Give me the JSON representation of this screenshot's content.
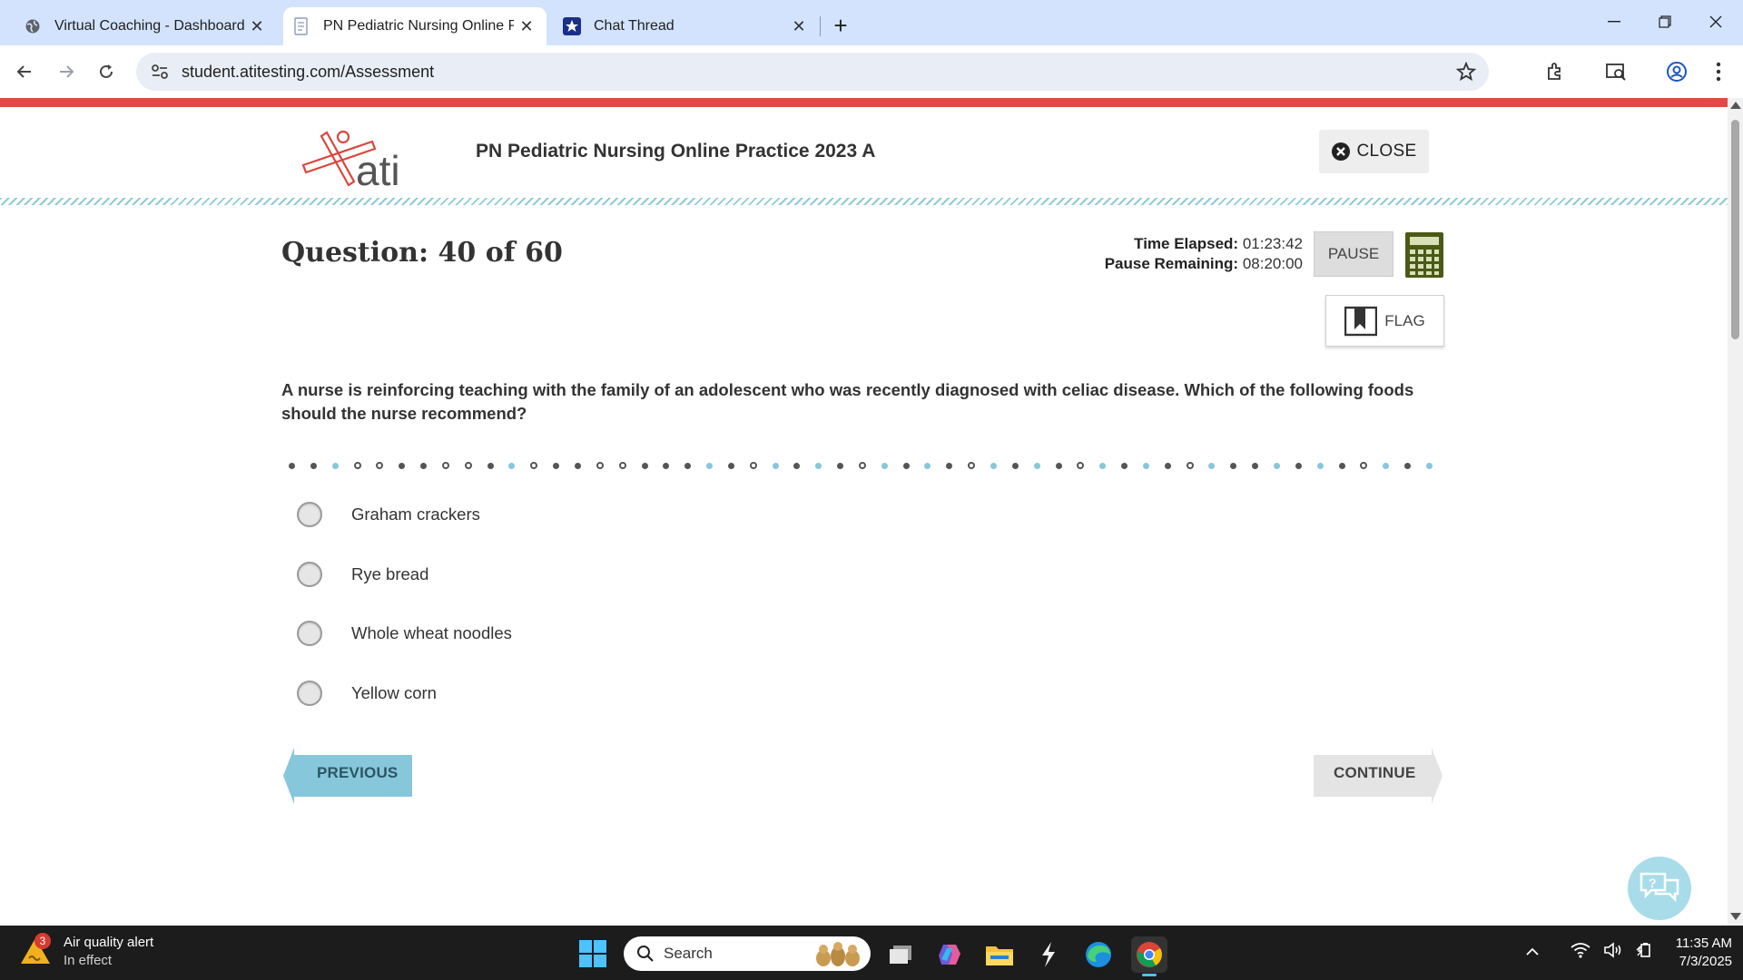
{
  "browser": {
    "tabs": [
      {
        "title": "Virtual Coaching - Dashboard",
        "icon": "globe-icon",
        "active": false
      },
      {
        "title": "PN Pediatric Nursing Online Pra",
        "icon": "document-icon",
        "active": true
      },
      {
        "title": "Chat Thread",
        "icon": "star-badge-icon",
        "active": false
      }
    ],
    "url": "student.atitesting.com/Assessment"
  },
  "header": {
    "logo_text": "ati",
    "exam_title": "PN Pediatric Nursing Online Practice 2023 A",
    "close_label": "CLOSE"
  },
  "status": {
    "question_label": "Question: 40 of 60",
    "time_elapsed_label": "Time Elapsed:",
    "time_elapsed_value": "01:23:42",
    "pause_remaining_label": "Pause Remaining:",
    "pause_remaining_value": "08:20:00",
    "pause_label": "PAUSE",
    "flag_label": "FLAG"
  },
  "question": {
    "text": "A nurse is reinforcing teaching with the family of an adolescent who was recently diagnosed with celiac disease. Which of the following foods should the nurse recommend?",
    "options": [
      "Graham crackers",
      "Rye bread",
      "Whole wheat noodles",
      "Yellow corn"
    ]
  },
  "progress_dots": [
    "d",
    "d",
    "b",
    "r",
    "r",
    "d",
    "d",
    "r",
    "r",
    "d",
    "b",
    "r",
    "d",
    "d",
    "r",
    "r",
    "d",
    "d",
    "d",
    "b",
    "d",
    "r",
    "b",
    "d",
    "b",
    "d",
    "r",
    "b",
    "d",
    "b",
    "d",
    "r",
    "b",
    "d",
    "b",
    "d",
    "r",
    "b",
    "d",
    "b",
    "d",
    "r",
    "b",
    "d",
    "d",
    "b",
    "d",
    "b",
    "d",
    "r",
    "b",
    "d",
    "b"
  ],
  "navigation": {
    "previous_label": "PREVIOUS",
    "continue_label": "CONTINUE"
  },
  "taskbar": {
    "alert_badge": "3",
    "alert_title": "Air quality alert",
    "alert_sub": "In effect",
    "search_label": "Search",
    "time": "11:35 AM",
    "date": "7/3/2025"
  },
  "colors": {
    "brand_red": "#e04a3f",
    "accent_teal": "#86c7dc",
    "calculator_green": "#4a5a16"
  }
}
